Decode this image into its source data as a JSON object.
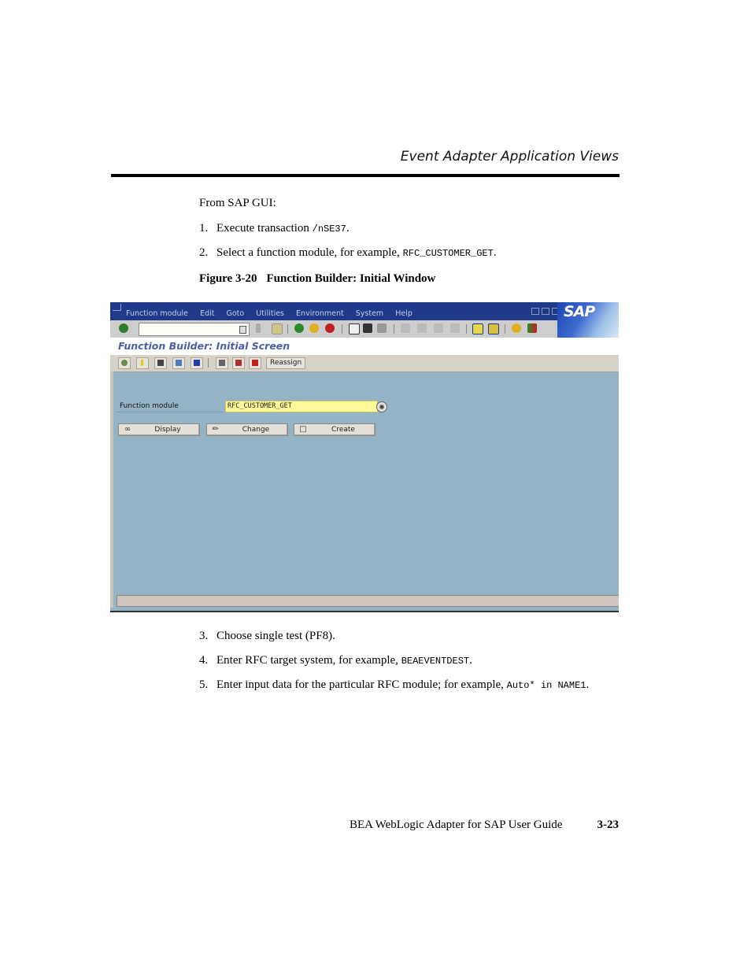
{
  "running_head": "Event Adapter Application Views",
  "intro": "From SAP GUI:",
  "steps_before": [
    {
      "num": "1.",
      "text": "Execute transaction ",
      "code": "/nSE37",
      "tail": "."
    },
    {
      "num": "2.",
      "text": "Select a function module, for example, ",
      "code": "RFC_CUSTOMER_GET",
      "tail": "."
    }
  ],
  "figure": {
    "label": "Figure 3-20",
    "title": "Function Builder: Initial Window"
  },
  "sap_window": {
    "menu": [
      "Function module",
      "Edit",
      "Goto",
      "Utilities",
      "Environment",
      "System",
      "Help"
    ],
    "logo": "SAP",
    "command_field": {
      "value": "",
      "placeholder": ""
    },
    "standard_toolbar": [
      "enter",
      "back-arrow",
      "save",
      "back",
      "exit",
      "cancel",
      "print",
      "find",
      "find-next",
      "first-page",
      "previous-page",
      "next-page",
      "last-page",
      "create-session",
      "shortcut",
      "help",
      "customize-layout"
    ],
    "title": "Function Builder: Initial Screen",
    "app_toolbar": {
      "icons": [
        "other-object",
        "where-used",
        "display-object-list",
        "hierarchy",
        "information",
        "delete",
        "copy",
        "rename"
      ],
      "reassign_label": "Reassign"
    },
    "function_module_label": "Function module",
    "function_module_value": "RFC_CUSTOMER_GET",
    "buttons": {
      "display": "Display",
      "change": "Change",
      "create": "Create"
    },
    "status_text": ""
  },
  "steps_after": [
    {
      "num": "3.",
      "text": "Choose single test (PF8).",
      "code": "",
      "tail": ""
    },
    {
      "num": "4.",
      "text": "Enter RFC target system, for example, ",
      "code": "BEAEVENTDEST",
      "tail": "."
    },
    {
      "num": "5.",
      "text": "Enter input data for the particular RFC module; for example, ",
      "code": "Auto* in NAME1",
      "tail": "."
    }
  ],
  "footer": {
    "book_title": "BEA WebLogic Adapter for SAP User Guide",
    "page_number": "3-23"
  }
}
